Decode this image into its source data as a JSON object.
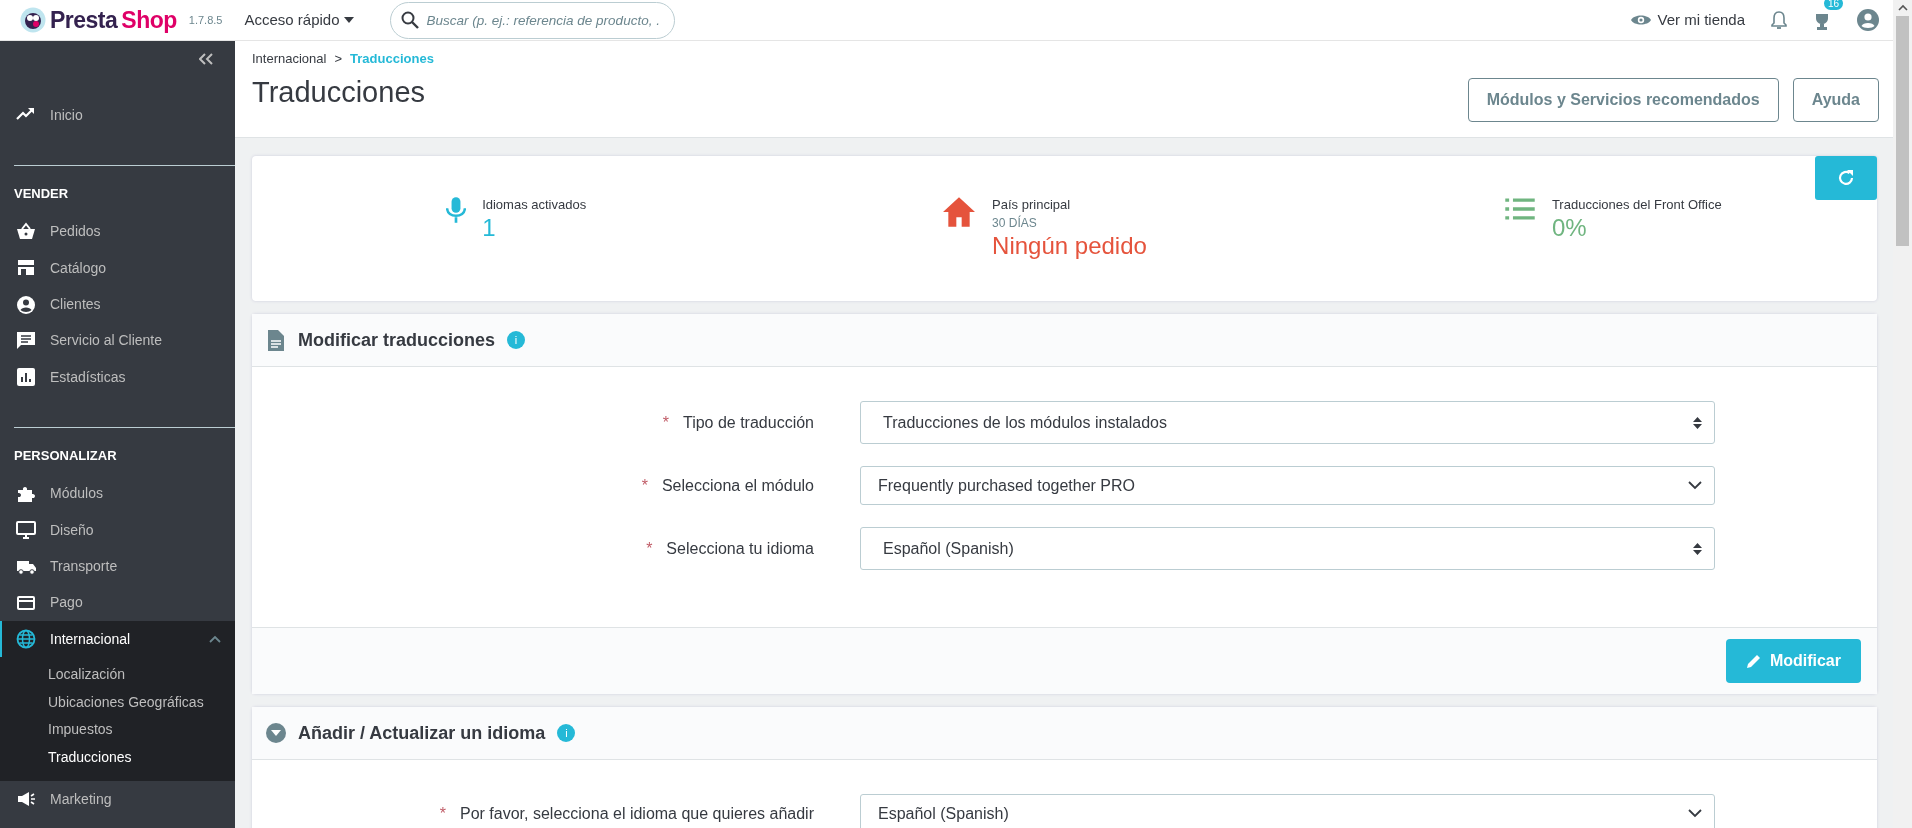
{
  "header": {
    "brand_first": "Presta",
    "brand_second": "Shop",
    "version": "1.7.8.5",
    "quick_access": "Acceso rápido",
    "search": {
      "placeholder": "Buscar (p. ej.: referencia de producto, ."
    },
    "view_store": "Ver mi tienda",
    "trophy_count": "16"
  },
  "sidebar": {
    "sections": [
      {
        "items": [
          {
            "label": "Inicio",
            "selected": false,
            "expanded": false
          }
        ]
      },
      {
        "heading": "VENDER",
        "items": [
          {
            "label": "Pedidos",
            "selected": false,
            "expanded": false
          },
          {
            "label": "Catálogo",
            "selected": false,
            "expanded": false
          },
          {
            "label": "Clientes",
            "selected": false,
            "expanded": false
          },
          {
            "label": "Servicio al Cliente",
            "selected": false,
            "expanded": false
          },
          {
            "label": "Estadísticas",
            "selected": false,
            "expanded": false
          }
        ]
      },
      {
        "heading": "PERSONALIZAR",
        "items": [
          {
            "label": "Módulos",
            "selected": false,
            "expanded": false
          },
          {
            "label": "Diseño",
            "selected": false,
            "expanded": false
          },
          {
            "label": "Transporte",
            "selected": false,
            "expanded": false
          },
          {
            "label": "Pago",
            "selected": false,
            "expanded": false
          },
          {
            "label": "Internacional",
            "selected": true,
            "expanded": true,
            "children": [
              {
                "label": "Localización",
                "selected": false
              },
              {
                "label": "Ubicaciones Geográficas",
                "selected": false
              },
              {
                "label": "Impuestos",
                "selected": false
              },
              {
                "label": "Traducciones",
                "selected": true
              }
            ]
          },
          {
            "label": "Marketing",
            "selected": false,
            "expanded": false
          }
        ]
      }
    ]
  },
  "breadcrumb": {
    "separator": ">",
    "items": [
      {
        "label": "Internacional",
        "selected": false
      },
      {
        "label": "Traducciones",
        "selected": true
      }
    ]
  },
  "page_title": "Traducciones",
  "toolbar_buttons": [
    "Módulos y Servicios recomendados",
    "Ayuda"
  ],
  "kpis": [
    {
      "label": "Idiomas activados",
      "value": "1",
      "color": "#25b9d7"
    },
    {
      "label": "País principal",
      "sublabel": "30 DÍAS",
      "value": "Ningún pedido",
      "color": "#e5533c"
    },
    {
      "label": "Traducciones del Front Office",
      "value": "0%",
      "color": "#70b580"
    }
  ],
  "panels": [
    {
      "title": "Modificar traducciones",
      "info": "i",
      "fields": [
        {
          "label": "Tipo de traducción",
          "required_mark": "*",
          "kind": "native",
          "value": "Traducciones de los módulos instalados"
        },
        {
          "label": "Selecciona el módulo",
          "required_mark": "*",
          "kind": "select2",
          "value": "Frequently purchased together PRO"
        },
        {
          "label": "Selecciona tu idioma",
          "required_mark": "*",
          "kind": "native",
          "value": "Español (Spanish)"
        }
      ],
      "footer_button": "Modificar"
    },
    {
      "title": "Añadir / Actualizar un idioma",
      "info": "i",
      "fields": [
        {
          "label": "Por favor, selecciona el idioma que quieres añadir",
          "required_mark": "*",
          "kind": "select2",
          "value": "Español (Spanish)"
        }
      ]
    }
  ]
}
